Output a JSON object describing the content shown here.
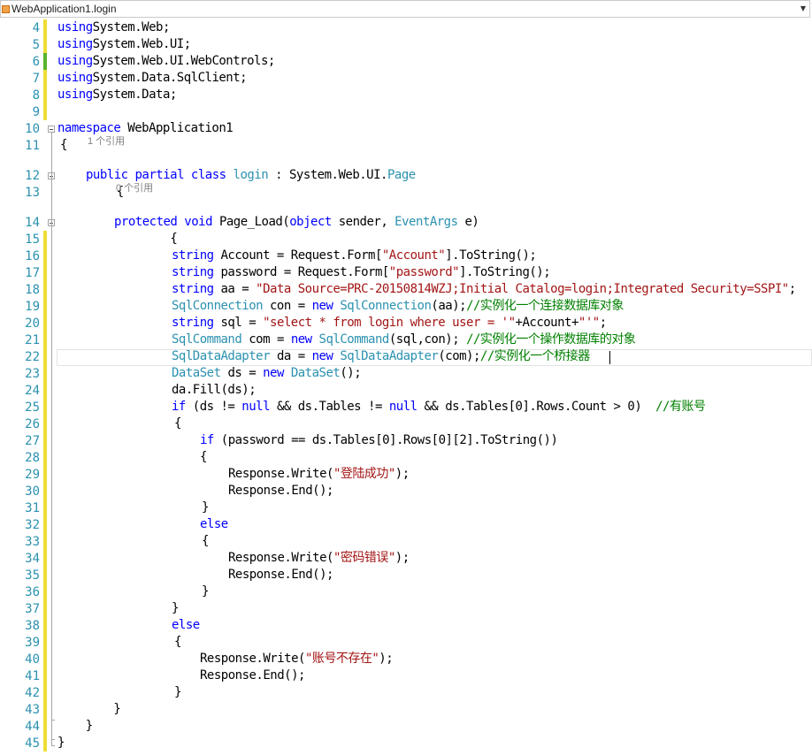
{
  "navbar": {
    "type_name": "WebApplication1.login",
    "dropdown_icon": "chevron-down-icon"
  },
  "line_numbers": [
    "4",
    "5",
    "6",
    "7",
    "8",
    "9",
    "10",
    "11",
    "12",
    "13",
    "14",
    "15",
    "16",
    "17",
    "18",
    "19",
    "20",
    "21",
    "22",
    "23",
    "24",
    "25",
    "26",
    "27",
    "28",
    "29",
    "30",
    "31",
    "32",
    "33",
    "34",
    "35",
    "36",
    "37",
    "38",
    "39",
    "40",
    "41",
    "42",
    "43",
    "44",
    "45"
  ],
  "codelens": [
    "1 个引用",
    "0 个引用"
  ],
  "code_lines": [
    [
      [
        "kw",
        "using"
      ],
      [
        "",
        "System.Web;"
      ]
    ],
    [
      [
        "kw",
        "using"
      ],
      [
        "",
        "System.Web.UI;"
      ]
    ],
    [
      [
        "kw",
        "using"
      ],
      [
        "",
        "System.Web.UI.WebControls;"
      ]
    ],
    [
      [
        "kw",
        "using"
      ],
      [
        "",
        "System.Data.SqlClient;"
      ]
    ],
    [
      [
        "kw",
        "using"
      ],
      [
        "",
        "System.Data;"
      ]
    ],
    [],
    [
      [
        "kw",
        "namespace"
      ],
      [
        "",
        " WebApplication1"
      ]
    ],
    [
      [
        "",
        "{"
      ]
    ],
    [
      [
        "",
        ""
      ],
      [
        "kw",
        "public partial class "
      ],
      [
        "ty",
        "login"
      ],
      [
        "",
        " : System.Web.UI."
      ],
      [
        "ty",
        "Page"
      ]
    ],
    [
      [
        "",
        "    {"
      ]
    ],
    [
      [
        "",
        ""
      ],
      [
        "kw",
        "protected void"
      ],
      [
        "",
        " Page_Load("
      ],
      [
        "kw",
        "object"
      ],
      [
        "",
        " sender, "
      ],
      [
        "ty",
        "EventArgs"
      ],
      [
        "",
        " e)"
      ]
    ],
    [
      [
        "",
        "        {"
      ]
    ],
    [
      [
        "kw",
        "string"
      ],
      [
        "",
        " Account = Request.Form["
      ],
      [
        "st",
        "\"Account\""
      ],
      [
        "",
        "].ToString();"
      ]
    ],
    [
      [
        "kw",
        "string"
      ],
      [
        "",
        " password = Request.Form["
      ],
      [
        "st",
        "\"password\""
      ],
      [
        "",
        "].ToString();"
      ]
    ],
    [
      [
        "kw",
        "string"
      ],
      [
        "",
        " aa = "
      ],
      [
        "st",
        "\"Data Source=PRC-20150814WZJ;Initial Catalog=login;Integrated Security=SSPI\""
      ],
      [
        "",
        ";"
      ]
    ],
    [
      [
        "ty",
        "SqlConnection"
      ],
      [
        "",
        " con = "
      ],
      [
        "kw",
        "new"
      ],
      [
        "",
        " "
      ],
      [
        "ty",
        "SqlConnection"
      ],
      [
        "",
        "(aa);"
      ],
      [
        "cm",
        "//实例化一个连接数据库对象"
      ]
    ],
    [
      [
        "kw",
        "string"
      ],
      [
        "",
        " sql = "
      ],
      [
        "st",
        "\"select * from login where user = '\""
      ],
      [
        "",
        "+Account+"
      ],
      [
        "st",
        "\"'\""
      ],
      [
        "",
        ";"
      ]
    ],
    [
      [
        "ty",
        "SqlCommand"
      ],
      [
        "",
        " com = "
      ],
      [
        "kw",
        "new"
      ],
      [
        "",
        " "
      ],
      [
        "ty",
        "SqlCommand"
      ],
      [
        "",
        "(sql,con); "
      ],
      [
        "cm",
        "//实例化一个操作数据库的对象"
      ]
    ],
    [
      [
        "ty",
        "SqlDataAdapter"
      ],
      [
        "",
        " da = "
      ],
      [
        "kw",
        "new"
      ],
      [
        "",
        " "
      ],
      [
        "ty",
        "SqlDataAdapter"
      ],
      [
        "",
        "(com);"
      ],
      [
        "cm",
        "//实例化一个桥接器"
      ]
    ],
    [
      [
        "ty",
        "DataSet"
      ],
      [
        "",
        " ds = "
      ],
      [
        "kw",
        "new"
      ],
      [
        "",
        " "
      ],
      [
        "ty",
        "DataSet"
      ],
      [
        "",
        "();"
      ]
    ],
    [
      [
        "",
        "da.Fill(ds);"
      ]
    ],
    [
      [
        "kw",
        "if"
      ],
      [
        "",
        " (ds != "
      ],
      [
        "kw",
        "null"
      ],
      [
        "",
        " && ds.Tables != "
      ],
      [
        "kw",
        "null"
      ],
      [
        "",
        " && ds.Tables[0].Rows.Count > 0)  "
      ],
      [
        "cm",
        "//有账号"
      ]
    ],
    [
      [
        "",
        "{"
      ]
    ],
    [
      [
        "kw",
        "if"
      ],
      [
        "",
        " (password == ds.Tables[0].Rows[0][2].ToString())"
      ]
    ],
    [
      [
        "",
        "{"
      ]
    ],
    [
      [
        "",
        "Response.Write("
      ],
      [
        "st",
        "\"登陆成功\""
      ],
      [
        "",
        ");"
      ]
    ],
    [
      [
        "",
        "Response.End();"
      ]
    ],
    [
      [
        "",
        "}"
      ]
    ],
    [
      [
        "kw",
        "else"
      ]
    ],
    [
      [
        "",
        "{"
      ]
    ],
    [
      [
        "",
        "Response.Write("
      ],
      [
        "st",
        "\"密码错误\""
      ],
      [
        "",
        ");"
      ]
    ],
    [
      [
        "",
        "Response.End();"
      ]
    ],
    [
      [
        "",
        "}"
      ]
    ],
    [
      [
        "",
        "}"
      ]
    ],
    [
      [
        "kw",
        "else"
      ]
    ],
    [
      [
        "",
        "{"
      ]
    ],
    [
      [
        "",
        "Response.Write("
      ],
      [
        "st",
        "\"账号不存在\""
      ],
      [
        "",
        ");"
      ]
    ],
    [
      [
        "",
        "Response.End();"
      ]
    ],
    [
      [
        "",
        "}"
      ]
    ],
    [
      [
        "",
        "        }"
      ]
    ],
    [
      [
        "",
        "    }"
      ]
    ],
    [
      [
        "",
        "}"
      ]
    ]
  ]
}
